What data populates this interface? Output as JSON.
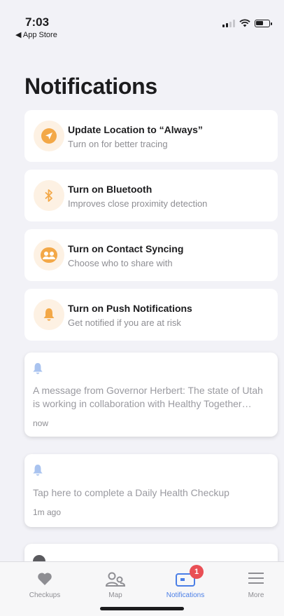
{
  "status_bar": {
    "time": "7:03",
    "back_label": "◀ App Store",
    "battery_level": 0.6
  },
  "page_title": "Notifications",
  "action_cards": [
    {
      "title": "Update Location to “Always”",
      "subtitle": "Turn on for better tracing",
      "icon": "location-arrow-icon"
    },
    {
      "title": "Turn on Bluetooth",
      "subtitle": "Improves close proximity detection",
      "icon": "bluetooth-icon"
    },
    {
      "title": "Turn on Contact Syncing",
      "subtitle": "Choose who to share with",
      "icon": "contacts-icon"
    },
    {
      "title": "Turn on Push Notifications",
      "subtitle": "Get notified if you are at risk",
      "icon": "bell-icon"
    }
  ],
  "messages": [
    {
      "text": "A message from Governor Herbert: The state of Utah is working in collaboration with Healthy Together…",
      "time": "now",
      "icon": "bell-icon"
    },
    {
      "text": "Tap here to complete a Daily Health Checkup",
      "time": "1m ago",
      "icon": "bell-icon"
    },
    {
      "icon": "info-icon"
    }
  ],
  "tab_bar": {
    "tabs": [
      {
        "label": "Checkups",
        "icon": "heart-icon",
        "active": false
      },
      {
        "label": "Map",
        "icon": "map-people-icon",
        "active": false
      },
      {
        "label": "Notifications",
        "icon": "notifications-card-icon",
        "active": true,
        "badge": "1"
      },
      {
        "label": "More",
        "icon": "menu-lines-icon",
        "active": false
      }
    ]
  },
  "colors": {
    "accent_orange": "#f3a847",
    "accent_blue": "#4a7ee6",
    "badge_red": "#e94f55",
    "message_bell": "#a9c3ef"
  }
}
